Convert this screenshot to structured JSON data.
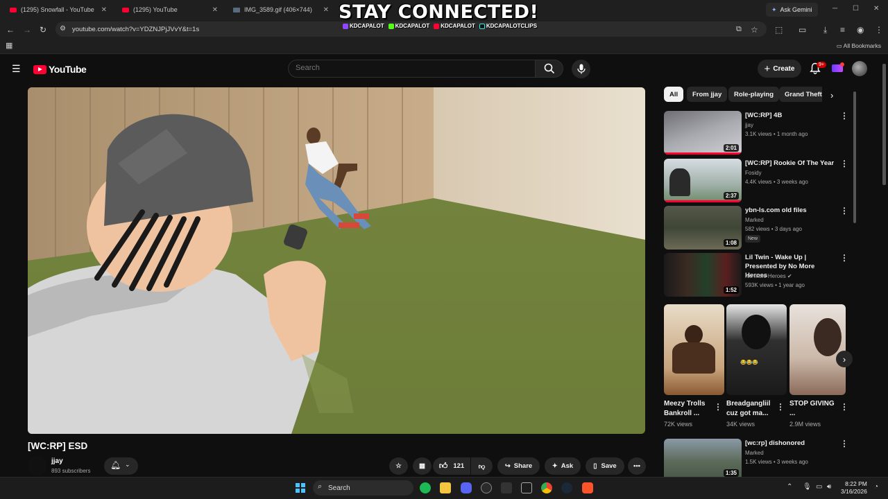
{
  "browser": {
    "tabs": [
      {
        "label": "(1295) Snowfall - YouTube"
      },
      {
        "label": "(1295) YouTube"
      },
      {
        "label": "IMG_3589.gif (406×744)"
      }
    ],
    "ask_gemini": "Ask Gemini",
    "url": "youtube.com/watch?v=YDZNJPjJVvY&t=1s",
    "all_bookmarks": "All Bookmarks"
  },
  "overlay": {
    "title": "STAY CONNECTED!",
    "socials": [
      "KDCAPALOT",
      "KDCAPALOT",
      "KDCAPALOT",
      "KDCAPALOTCLIPS"
    ]
  },
  "youtube": {
    "logo_text": "YouTube",
    "search_placeholder": "Search",
    "create_label": "Create",
    "notif_count": "9+"
  },
  "video": {
    "title": "[WC:RP] ESD",
    "channel": "jjay",
    "subscribers": "893 subscribers",
    "likes": "121",
    "share_label": "Share",
    "ask_label": "Ask",
    "save_label": "Save"
  },
  "chips": [
    "All",
    "From jjay",
    "Role-playing",
    "Grand Theft"
  ],
  "recommendations": [
    {
      "title": "[WC:RP] 4B",
      "channel": "jjay",
      "meta": "3.1K views • 1 month ago",
      "duration": "2:01"
    },
    {
      "title": "[WC:RP] Rookie Of The Year",
      "channel": "Fosidy",
      "meta": "4.4K views • 3 weeks ago",
      "duration": "2:37"
    },
    {
      "title": "ybn-ls.com old files",
      "channel": "Marked",
      "meta": "582 views • 3 days ago",
      "duration": "1:08",
      "badge": "New"
    },
    {
      "title": "Lil Twin - Wake Up | Presented by No More Heroes",
      "channel": "No More Heroes",
      "meta": "593K views • 1 year ago",
      "duration": "1:52"
    }
  ],
  "shorts": [
    {
      "title": "Meezy Trolls Bankroll ...",
      "views": "72K views"
    },
    {
      "title": "Breadgangliil cuz got ma...",
      "views": "34K views"
    },
    {
      "title": "STOP GIVING ...",
      "views": "2.9M views"
    }
  ],
  "rec_bottom": {
    "title": "[wc:rp] dishonored",
    "channel": "Marked",
    "meta": "1.5K views • 3 weeks ago",
    "duration": "1:35"
  },
  "taskbar": {
    "search_label": "Search",
    "time": "8:22 PM",
    "date": "3/16/2026"
  },
  "colors": {
    "accent": "#ff0033",
    "bg": "#0f0f0f",
    "chip": "#272727"
  }
}
